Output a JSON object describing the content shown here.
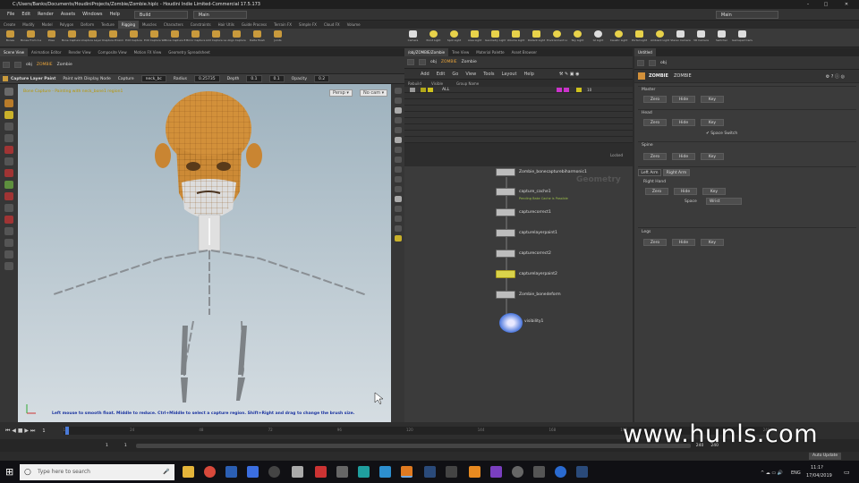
{
  "window": {
    "title": "C:/Users/Banks/Documents/HoudiniProjects/Zombie/Zombie.hiplc - Houdini Indie Limited-Commercial 17.5.173"
  },
  "menu": [
    "File",
    "Edit",
    "Render",
    "Assets",
    "Windows",
    "Help"
  ],
  "desktop": {
    "build": "Build",
    "main": "Main",
    "main_right": "Main"
  },
  "shelf_tabs": [
    "Create",
    "Modify",
    "Model",
    "Polygon",
    "Deform",
    "Texture",
    "Rigging",
    "Muscles",
    "Characters",
    "Constraints",
    "Hair Utils",
    "Guide Process",
    "Terrain FX",
    "Simple FX",
    "Cloud FX",
    "Volume"
  ],
  "shelf_tools": [
    "Bones",
    "Bones From Curve",
    "Pose",
    "Bone Capture Lines",
    "Capture Layer Paint",
    "Capture Proximity",
    "Edit Capture",
    "Edit Capture Weights",
    "Bone Capture Biharmonic",
    "Mirror Capture",
    "Add Capture Layer",
    "Align Capture",
    "Delta Mush",
    "Joints"
  ],
  "shelf_tools_right": [
    "Camera",
    "Point Light",
    "Spot Light",
    "Area Light",
    "Geometry Light",
    "Volume Light",
    "Distant Light",
    "Environment Light",
    "Sky Light",
    "GI Light",
    "Caustic Light",
    "Portal Light",
    "Ambient Light",
    "Stereo Camera",
    "VR Camera",
    "Switcher",
    "Gamepad Camera"
  ],
  "left_pane": {
    "tabs": [
      "Scene View",
      "Animation Editor",
      "Render View",
      "Composite View",
      "Motion FX View",
      "Geometry Spreadsheet"
    ],
    "path": [
      "obj",
      "ZOMBIE",
      "Zombie"
    ],
    "operator": {
      "name": "Capture Layer Paint",
      "mode": "Paint with Display Node",
      "capture_label": "Capture",
      "capture_value": "neck_bc",
      "radius_label": "Radius",
      "radius_value": "0.25735",
      "depth_label": "Depth",
      "depth_a": "0.1",
      "depth_b": "0.1",
      "opacity_label": "Opacity",
      "opacity_value": "0.2"
    },
    "viewport": {
      "label": "Bone Capture - Painting with neck_bone1 region1",
      "persp": "Persp ▾",
      "cam": "No cam ▾",
      "hint": "Left mouse to smooth float. Middle to reduce. Ctrl+Middle to select a capture region. Shift+Right and drag to change the brush size.",
      "frame": "1"
    }
  },
  "mid_pane": {
    "tabs": [
      "/obj/ZOMBIE/Zombie",
      "Tree View",
      "Material Palette",
      "Asset Browser"
    ],
    "path": [
      "obj",
      "ZOMBIE",
      "Zombie"
    ],
    "sheet_menu": [
      "Add",
      "Edit",
      "Go",
      "View",
      "Tools",
      "Layout",
      "Help"
    ],
    "sheet_headers": [
      "Rebuild",
      "Visible",
      "Group Name"
    ],
    "sheet_row": "ALL",
    "sheet_scroll_value": "10",
    "sheet_footer": "Locked",
    "net_label": "Geometry",
    "nodes": [
      {
        "name": "Zombie_bonecapturebiharmonic1"
      },
      {
        "name": "capture_cache1",
        "sub": "Pending Bake Cache is Possible"
      },
      {
        "name": "capturecorrect1"
      },
      {
        "name": "capturelayerpaint1"
      },
      {
        "name": "capturecorrect2"
      },
      {
        "name": "capturelayerpaint2"
      },
      {
        "name": "Zombie_bonedeform"
      },
      {
        "name": "visibility1"
      }
    ]
  },
  "right_pane": {
    "tabs": [
      "Untitled"
    ],
    "path": [
      "obj"
    ],
    "node_type": "ZOMBIE",
    "node_name": "ZOMBIE",
    "groups": [
      {
        "title": "Master",
        "buttons": [
          "Zero",
          "Hide",
          "Key"
        ]
      },
      {
        "title": "Head",
        "buttons": [
          "Zero",
          "Hide",
          "Key"
        ],
        "toggle": "Space Switch"
      },
      {
        "title": "Spine",
        "buttons": [
          "Zero",
          "Hide",
          "Key"
        ]
      },
      {
        "title": "Right Hand",
        "tabs": [
          "Left Arm",
          "Right Arm"
        ],
        "buttons": [
          "Zero",
          "Hide",
          "Key"
        ],
        "space_label": "Space",
        "space_value": "Wrist"
      },
      {
        "title": "Legs",
        "buttons": [
          "Zero",
          "Hide",
          "Key"
        ]
      }
    ]
  },
  "timeline": {
    "frame": "1",
    "start": "1",
    "end": "240",
    "end2": "240",
    "ticks": [
      "1",
      "24",
      "48",
      "72",
      "96",
      "120",
      "144",
      "168",
      "192",
      "216",
      "240"
    ],
    "auto_update": "Auto Update"
  },
  "taskbar": {
    "search_placeholder": "Type here to search",
    "lang": "ENG",
    "time": "11:1?",
    "date": "17/04/2019"
  },
  "watermark": "www.hunls.com",
  "colors": {
    "accent_orange": "#d2903a",
    "node_selected": "#d9d34a",
    "viewport_top": "#9eb2be",
    "viewport_bottom": "#d5dde2"
  }
}
